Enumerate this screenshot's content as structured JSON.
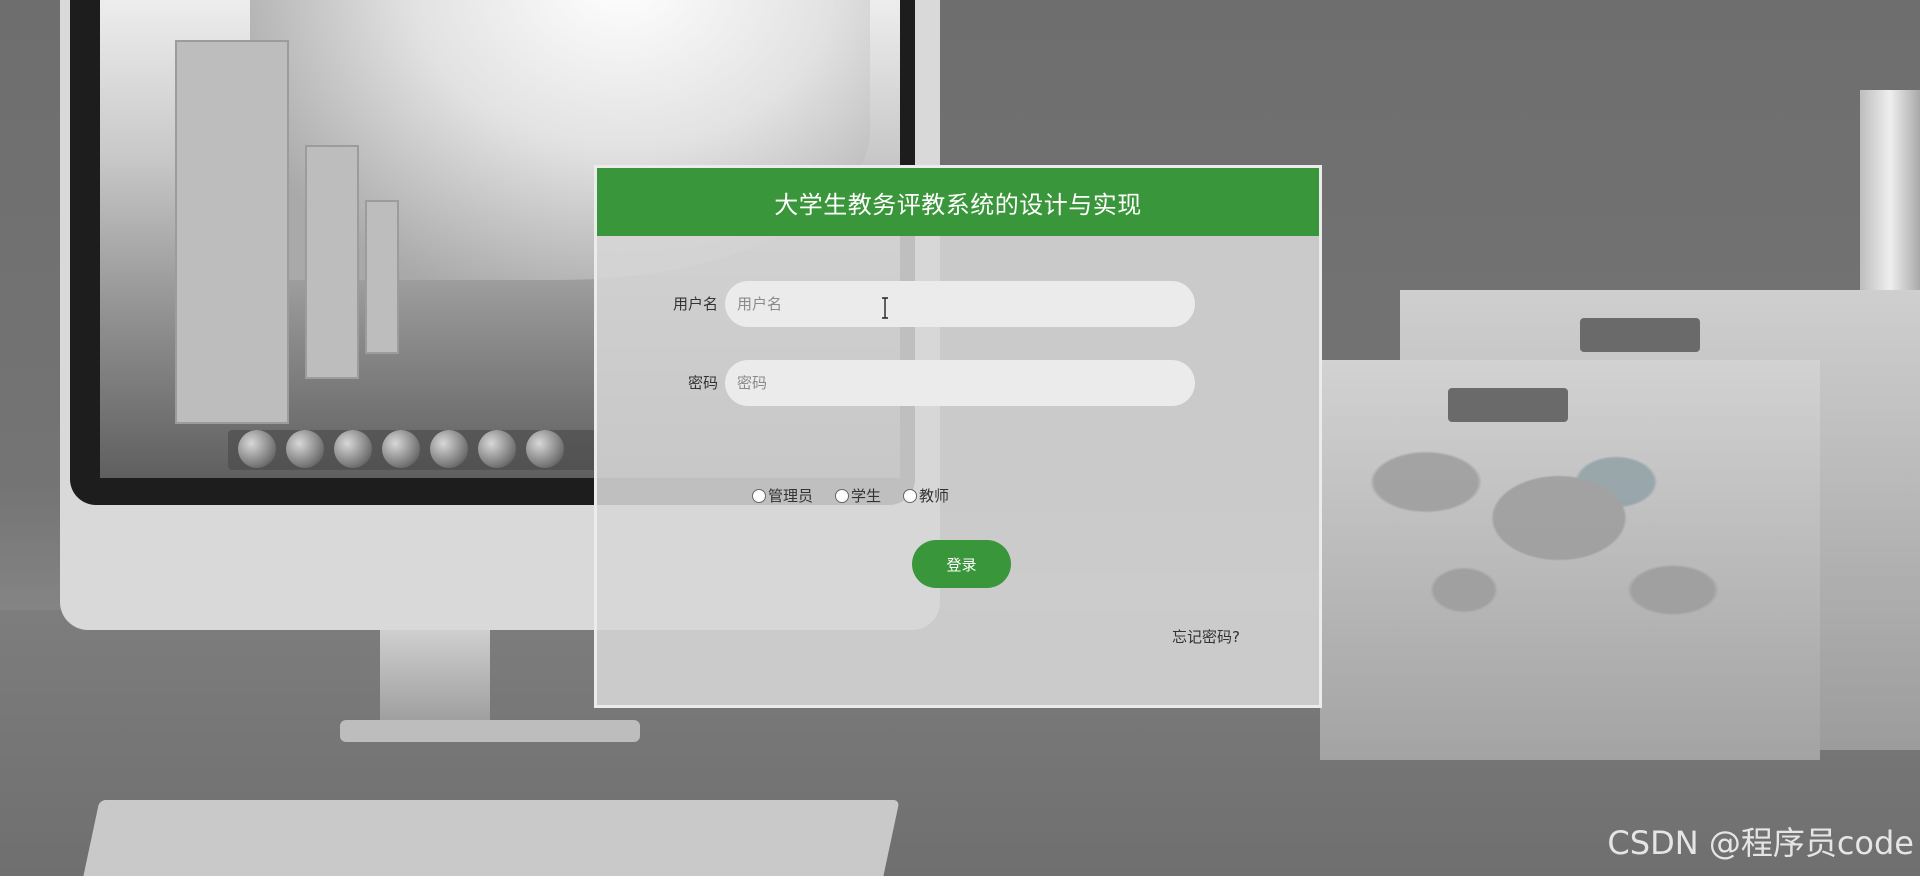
{
  "login": {
    "title": "大学生教务评教系统的设计与实现",
    "username_label": "用户名",
    "username_placeholder": "用户名",
    "username_value": "",
    "password_label": "密码",
    "password_placeholder": "密码",
    "password_value": "",
    "roles": [
      {
        "label": "管理员",
        "checked": false
      },
      {
        "label": "学生",
        "checked": false
      },
      {
        "label": "教师",
        "checked": false
      }
    ],
    "login_button": "登录",
    "forgot_link": "忘记密码?"
  },
  "watermark": "CSDN @程序员code",
  "colors": {
    "brand_green": "#3a963a",
    "panel_bg": "#d6d6d6",
    "input_bg": "#ebebeb"
  },
  "icons": [
    "text-cursor-icon"
  ]
}
